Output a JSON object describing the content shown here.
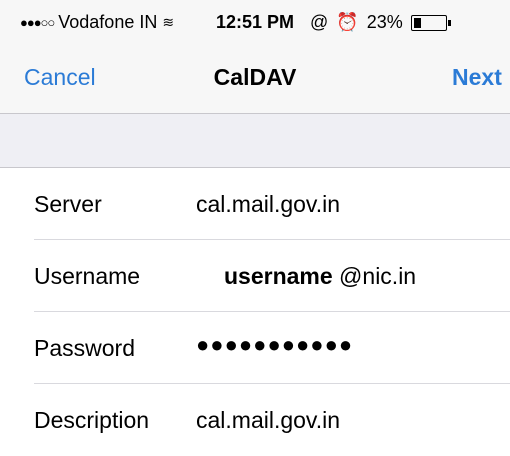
{
  "status_bar": {
    "signal": "●●●○○",
    "carrier": "Vodafone IN",
    "wifi_icon": "wifi-icon",
    "time": "12:51 PM",
    "lock_icon": "@",
    "alarm_icon": "⏰",
    "battery": "23%",
    "battery_level": 0.23
  },
  "nav": {
    "cancel_label": "Cancel",
    "title": "CalDAV",
    "next_label": "Next"
  },
  "form": {
    "server": {
      "label": "Server",
      "value": "cal.mail.gov.in"
    },
    "username": {
      "label": "Username",
      "bold_part": "username",
      "suffix": " @nic.in"
    },
    "password": {
      "label": "Password",
      "value": "●●●●●●●●●●●"
    },
    "description": {
      "label": "Description",
      "value": "cal.mail.gov.in"
    }
  },
  "colors": {
    "accent": "#2b7bd6",
    "background": "#efeff4"
  }
}
